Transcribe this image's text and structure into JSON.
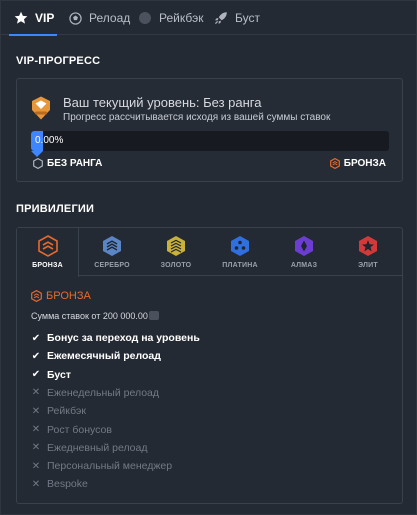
{
  "tabs": [
    {
      "label": "VIP",
      "icon": "star-icon"
    },
    {
      "label": "Релоад",
      "icon": "soccer-ball-icon"
    },
    {
      "label": "Рейкбэк",
      "icon": "rakeback-icon"
    },
    {
      "label": "Буст",
      "icon": "rocket-icon"
    }
  ],
  "progress": {
    "section_title": "VIP-ПРОГРЕСС",
    "current_level": "Ваш текущий уровень: Без ранга",
    "subtitle": "Прогресс рассчитывается исходя из вашей суммы ставок",
    "percent_text": "0.00%",
    "percent_value": 0,
    "from_rank": "БЕЗ РАНГА",
    "to_rank": "БРОНЗА"
  },
  "privileges": {
    "section_title": "ПРИВИЛЕГИИ",
    "tiers": [
      {
        "label": "БРОНЗА",
        "color": "#e8692c",
        "icon": "bronze-tier-icon"
      },
      {
        "label": "СЕРЕБРО",
        "color": "#5b86c6",
        "icon": "silver-tier-icon"
      },
      {
        "label": "ЗОЛОТО",
        "color": "#c9b13a",
        "icon": "gold-tier-icon"
      },
      {
        "label": "ПЛАТИНА",
        "color": "#2f6fe0",
        "icon": "platinum-tier-icon"
      },
      {
        "label": "АЛМАЗ",
        "color": "#6b3ed1",
        "icon": "diamond-tier-icon"
      },
      {
        "label": "ЭЛИТ",
        "color": "#d23a3a",
        "icon": "elite-tier-icon"
      }
    ],
    "selected": {
      "title": "БРОНЗА",
      "wager": "Сумма ставок от 200 000.00",
      "features": [
        {
          "label": "Бонус за переход на уровень",
          "enabled": true
        },
        {
          "label": "Ежемесячный релоад",
          "enabled": true
        },
        {
          "label": "Буст",
          "enabled": true
        },
        {
          "label": "Еженедельный релоад",
          "enabled": false
        },
        {
          "label": "Рейкбэк",
          "enabled": false
        },
        {
          "label": "Рост бонусов",
          "enabled": false
        },
        {
          "label": "Ежедневный релоад",
          "enabled": false
        },
        {
          "label": "Персональный менеджер",
          "enabled": false
        },
        {
          "label": "Bespoke",
          "enabled": false
        }
      ]
    }
  }
}
